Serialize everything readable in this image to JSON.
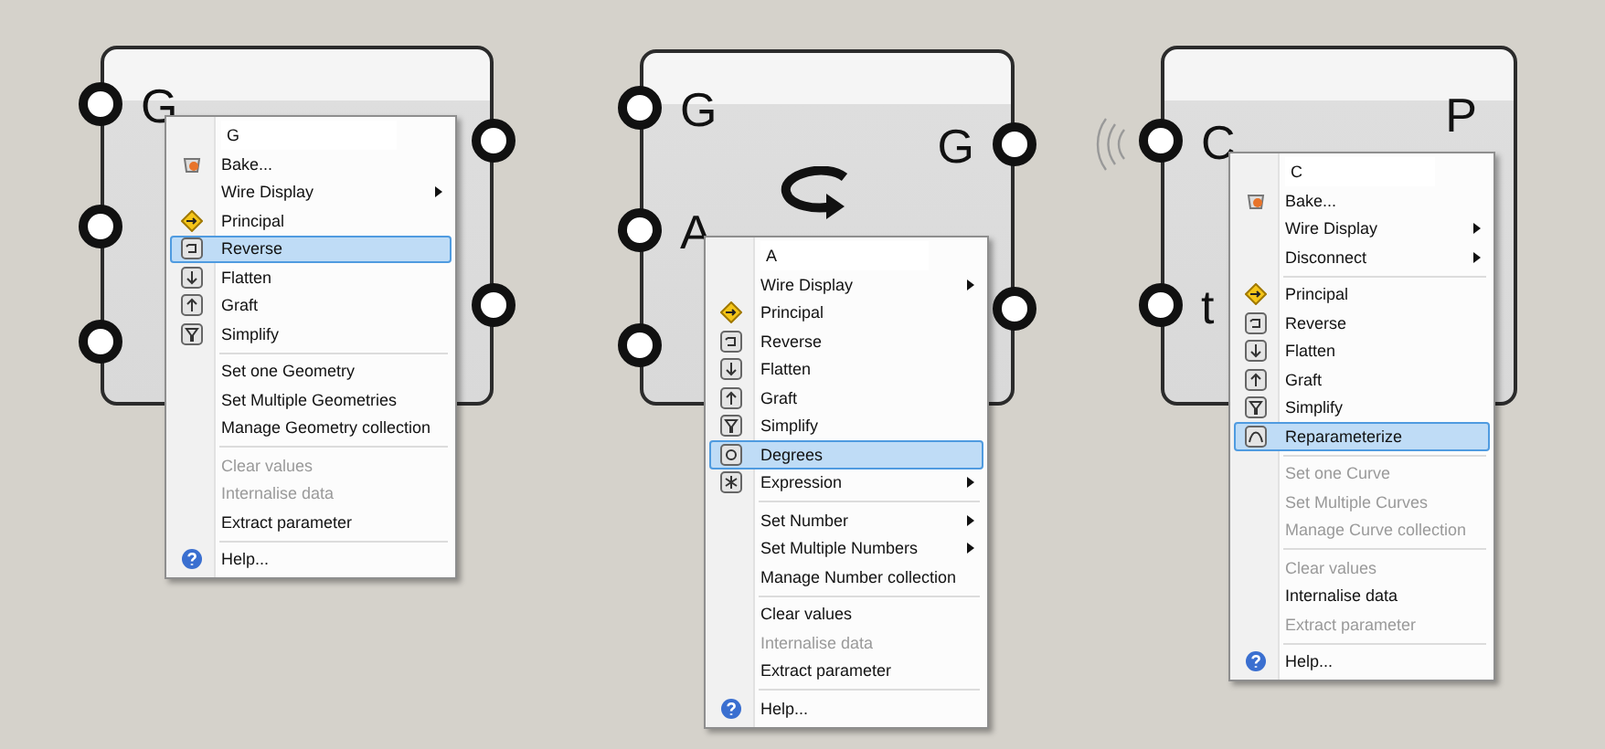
{
  "components": [
    {
      "kind": "plain",
      "inputs": [
        {
          "kind": "port",
          "label": "G"
        },
        {
          "kind": "port"
        },
        {
          "kind": "port"
        }
      ],
      "outputs": [
        {
          "kind": "port"
        },
        {
          "kind": "port"
        }
      ],
      "menu": [
        {
          "kind": "title",
          "label": "G"
        },
        {
          "kind": "bake",
          "label": "Bake...",
          "submenu": false,
          "disabled": false,
          "selected": false
        },
        {
          "kind": "plain",
          "label": "Wire Display",
          "submenu": true,
          "disabled": false,
          "selected": false
        },
        {
          "kind": "principal",
          "label": "Principal",
          "submenu": false,
          "disabled": false,
          "selected": false
        },
        {
          "kind": "reverse",
          "label": "Reverse",
          "submenu": false,
          "disabled": false,
          "selected": true
        },
        {
          "kind": "flatten",
          "label": "Flatten",
          "submenu": false,
          "disabled": false,
          "selected": false
        },
        {
          "kind": "graft",
          "label": "Graft",
          "submenu": false,
          "disabled": false,
          "selected": false
        },
        {
          "kind": "simplify",
          "label": "Simplify",
          "submenu": false,
          "disabled": false,
          "selected": false
        },
        {
          "kind": "separator"
        },
        {
          "kind": "plain",
          "label": "Set one Geometry",
          "submenu": false,
          "disabled": false,
          "selected": false
        },
        {
          "kind": "plain",
          "label": "Set Multiple Geometries",
          "submenu": false,
          "disabled": false,
          "selected": false
        },
        {
          "kind": "plain",
          "label": "Manage Geometry collection",
          "submenu": false,
          "disabled": false,
          "selected": false
        },
        {
          "kind": "separator"
        },
        {
          "kind": "plain",
          "label": "Clear values",
          "submenu": false,
          "disabled": true,
          "selected": false
        },
        {
          "kind": "plain",
          "label": "Internalise data",
          "submenu": false,
          "disabled": true,
          "selected": false
        },
        {
          "kind": "plain",
          "label": "Extract parameter",
          "submenu": false,
          "disabled": false,
          "selected": false
        },
        {
          "kind": "separator"
        },
        {
          "kind": "help",
          "label": "Help...",
          "submenu": false,
          "disabled": false,
          "selected": false
        }
      ]
    },
    {
      "kind": "rotate",
      "inputs": [
        {
          "kind": "port",
          "label": "G"
        },
        {
          "kind": "port",
          "label": "A"
        },
        {
          "kind": "port"
        }
      ],
      "outputs": [
        {
          "kind": "port",
          "label": "G"
        },
        {
          "kind": "port"
        }
      ],
      "menu": [
        {
          "kind": "title",
          "label": "A"
        },
        {
          "kind": "plain",
          "label": "Wire Display",
          "submenu": true,
          "disabled": false,
          "selected": false
        },
        {
          "kind": "principal",
          "label": "Principal",
          "submenu": false,
          "disabled": false,
          "selected": false
        },
        {
          "kind": "reverse",
          "label": "Reverse",
          "submenu": false,
          "disabled": false,
          "selected": false
        },
        {
          "kind": "flatten",
          "label": "Flatten",
          "submenu": false,
          "disabled": false,
          "selected": false
        },
        {
          "kind": "graft",
          "label": "Graft",
          "submenu": false,
          "disabled": false,
          "selected": false
        },
        {
          "kind": "simplify",
          "label": "Simplify",
          "submenu": false,
          "disabled": false,
          "selected": false
        },
        {
          "kind": "degrees",
          "label": "Degrees",
          "submenu": false,
          "disabled": false,
          "selected": true
        },
        {
          "kind": "expression",
          "label": "Expression",
          "submenu": true,
          "disabled": false,
          "selected": false
        },
        {
          "kind": "separator"
        },
        {
          "kind": "plain",
          "label": "Set Number",
          "submenu": true,
          "disabled": false,
          "selected": false
        },
        {
          "kind": "plain",
          "label": "Set Multiple Numbers",
          "submenu": true,
          "disabled": false,
          "selected": false
        },
        {
          "kind": "plain",
          "label": "Manage Number collection",
          "submenu": false,
          "disabled": false,
          "selected": false
        },
        {
          "kind": "separator"
        },
        {
          "kind": "plain",
          "label": "Clear values",
          "submenu": false,
          "disabled": false,
          "selected": false
        },
        {
          "kind": "plain",
          "label": "Internalise data",
          "submenu": false,
          "disabled": true,
          "selected": false
        },
        {
          "kind": "plain",
          "label": "Extract parameter",
          "submenu": false,
          "disabled": false,
          "selected": false
        },
        {
          "kind": "separator"
        },
        {
          "kind": "help",
          "label": "Help...",
          "submenu": false,
          "disabled": false,
          "selected": false
        }
      ]
    },
    {
      "kind": "plain",
      "wireless": true,
      "inputs": [
        {
          "kind": "port",
          "label": "C"
        },
        {
          "kind": "port",
          "label": "t"
        }
      ],
      "outputs": [
        {
          "kind": "bare",
          "label": "P"
        }
      ],
      "menu": [
        {
          "kind": "title",
          "label": "C"
        },
        {
          "kind": "bake",
          "label": "Bake...",
          "submenu": false,
          "disabled": false,
          "selected": false
        },
        {
          "kind": "plain",
          "label": "Wire Display",
          "submenu": true,
          "disabled": false,
          "selected": false
        },
        {
          "kind": "plain",
          "label": "Disconnect",
          "submenu": true,
          "disabled": false,
          "selected": false
        },
        {
          "kind": "separator"
        },
        {
          "kind": "principal",
          "label": "Principal",
          "submenu": false,
          "disabled": false,
          "selected": false
        },
        {
          "kind": "reverse",
          "label": "Reverse",
          "submenu": false,
          "disabled": false,
          "selected": false
        },
        {
          "kind": "flatten",
          "label": "Flatten",
          "submenu": false,
          "disabled": false,
          "selected": false
        },
        {
          "kind": "graft",
          "label": "Graft",
          "submenu": false,
          "disabled": false,
          "selected": false
        },
        {
          "kind": "simplify",
          "label": "Simplify",
          "submenu": false,
          "disabled": false,
          "selected": false
        },
        {
          "kind": "reparameterize",
          "label": "Reparameterize",
          "submenu": false,
          "disabled": false,
          "selected": true
        },
        {
          "kind": "separator"
        },
        {
          "kind": "plain",
          "label": "Set one Curve",
          "submenu": false,
          "disabled": true,
          "selected": false
        },
        {
          "kind": "plain",
          "label": "Set Multiple Curves",
          "submenu": false,
          "disabled": true,
          "selected": false
        },
        {
          "kind": "plain",
          "label": "Manage Curve collection",
          "submenu": false,
          "disabled": true,
          "selected": false
        },
        {
          "kind": "separator"
        },
        {
          "kind": "plain",
          "label": "Clear values",
          "submenu": false,
          "disabled": true,
          "selected": false
        },
        {
          "kind": "plain",
          "label": "Internalise data",
          "submenu": false,
          "disabled": false,
          "selected": false
        },
        {
          "kind": "plain",
          "label": "Extract parameter",
          "submenu": false,
          "disabled": true,
          "selected": false
        },
        {
          "kind": "separator"
        },
        {
          "kind": "help",
          "label": "Help...",
          "submenu": false,
          "disabled": false,
          "selected": false
        }
      ]
    }
  ]
}
